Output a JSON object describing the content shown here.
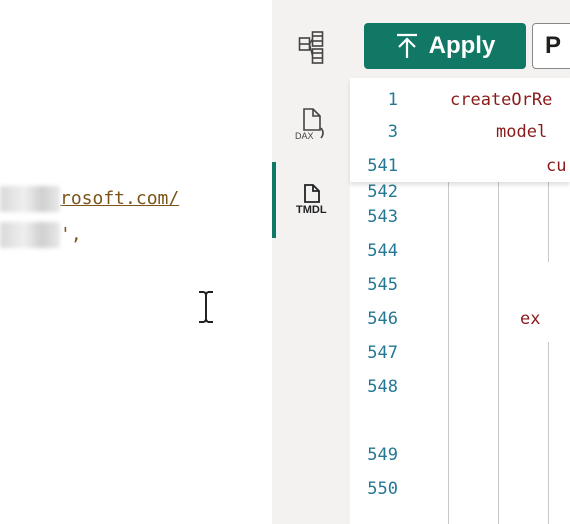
{
  "left_editor": {
    "line1_suffix": "rosoft.com/",
    "line2_suffix": "',"
  },
  "sidebar": {
    "items": [
      {
        "name": "model-view",
        "icon": "model-view-icon",
        "label": ""
      },
      {
        "name": "dax",
        "icon": "dax-query-icon",
        "label": "DAX"
      },
      {
        "name": "tmdl",
        "icon": "tmdl-icon",
        "label": "TMDL",
        "active": true
      }
    ]
  },
  "toolbar": {
    "apply_label": "Apply",
    "second_label": "P"
  },
  "code": {
    "sticky_lines": [
      {
        "num": "1",
        "text": "createOrRe"
      },
      {
        "num": "3",
        "text": "model"
      },
      {
        "num": "541",
        "text": "cu"
      }
    ],
    "lines": [
      {
        "num": "542",
        "text": ""
      },
      {
        "num": "543",
        "text": ""
      },
      {
        "num": "544",
        "text": ""
      },
      {
        "num": "545",
        "text": ""
      },
      {
        "num": "546",
        "text": "ex"
      },
      {
        "num": "547",
        "text": ""
      },
      {
        "num": "548",
        "text": ""
      },
      {
        "num": "549",
        "text": ""
      },
      {
        "num": "550",
        "text": ""
      }
    ]
  },
  "colors": {
    "accent": "#117865",
    "line_number": "#237893",
    "keyword": "#8b1a1a",
    "string": "#7a5418"
  }
}
